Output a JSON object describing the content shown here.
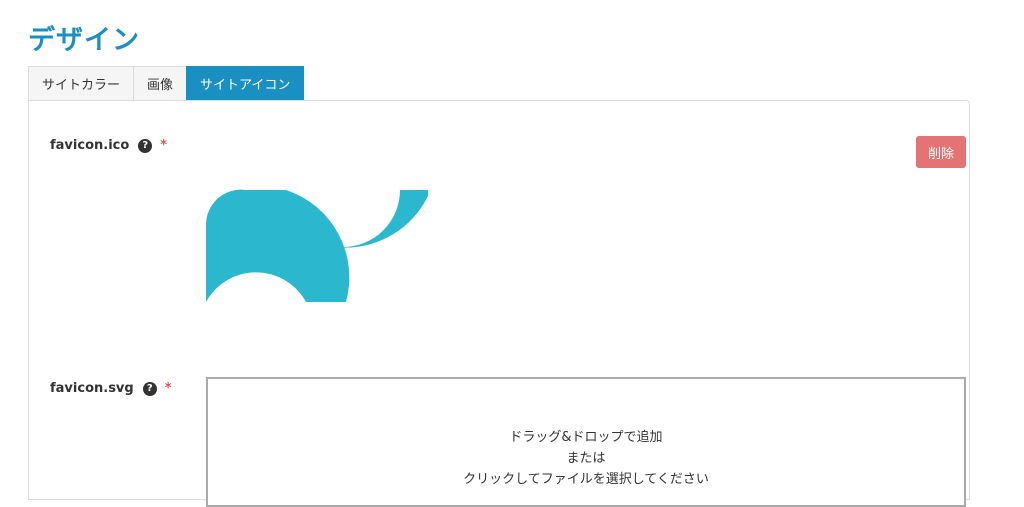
{
  "page": {
    "title": "デザイン"
  },
  "tabs": [
    {
      "label": "サイトカラー",
      "active": false
    },
    {
      "label": "画像",
      "active": false
    },
    {
      "label": "サイトアイコン",
      "active": true
    }
  ],
  "fields": {
    "favicon_ico": {
      "label": "favicon.ico",
      "required_mark": "*",
      "help_glyph": "?",
      "delete_label": "削除",
      "icon": "favicon-preview-icon"
    },
    "favicon_svg": {
      "label": "favicon.svg",
      "required_mark": "*",
      "help_glyph": "?"
    }
  },
  "dropzone": {
    "line1": "ドラッグ&ドロップで追加",
    "line2": "または",
    "line3": "クリックしてファイルを選択してください"
  },
  "colors": {
    "accent": "#1a8fc1",
    "danger": "#e57373",
    "logo": "#2bb8cf"
  }
}
